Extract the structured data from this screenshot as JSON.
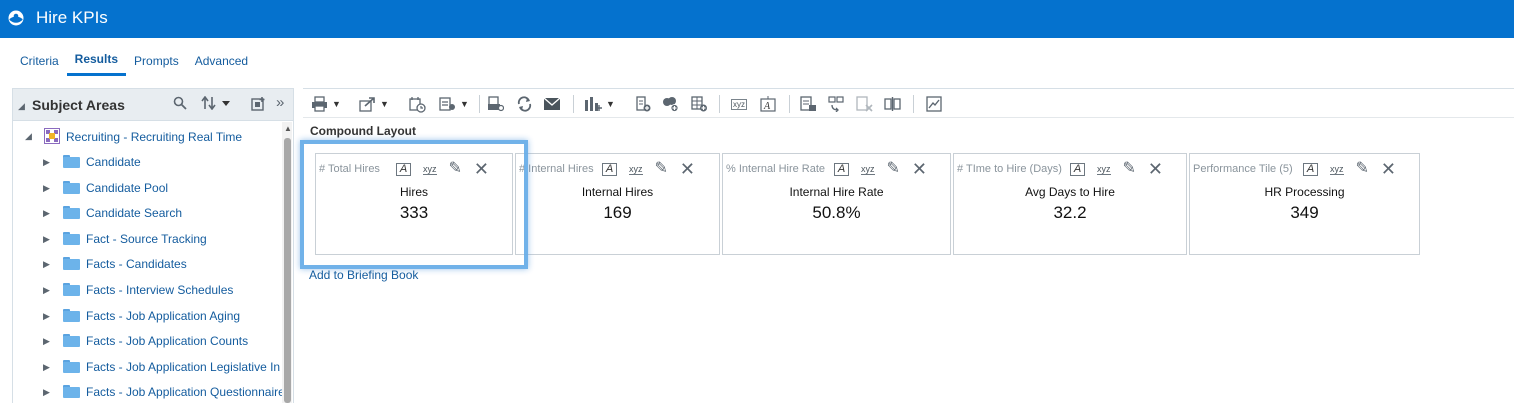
{
  "header": {
    "title": "Hire KPIs"
  },
  "tabs": [
    {
      "label": "Criteria"
    },
    {
      "label": "Results"
    },
    {
      "label": "Prompts"
    },
    {
      "label": "Advanced"
    }
  ],
  "subject_areas": {
    "title": "Subject Areas",
    "root": "Recruiting - Recruiting Real Time",
    "items": [
      "Candidate",
      "Candidate Pool",
      "Candidate Search",
      "Fact - Source Tracking",
      "Facts - Candidates",
      "Facts - Interview Schedules",
      "Facts - Job Application Aging",
      "Facts - Job Application Counts",
      "Facts - Job Application Legislative In",
      "Facts - Job Application Questionnaire"
    ]
  },
  "compound_layout": {
    "title": "Compound Layout",
    "add_to_briefing": "Add to Briefing Book"
  },
  "tiles": [
    {
      "label": "# Total Hires",
      "name": "Hires",
      "value": "333"
    },
    {
      "label": "# Internal Hires",
      "name": "Internal Hires",
      "value": "169"
    },
    {
      "label": "% Internal Hire Rate",
      "name": "Internal Hire Rate",
      "value": "50.8%"
    },
    {
      "label": "# TIme to Hire (Days)",
      "name": "Avg Days to Hire",
      "value": "32.2"
    },
    {
      "label": "Performance Tile (5)",
      "name": "HR Processing",
      "value": "349"
    }
  ],
  "icons": {
    "rename": "A",
    "format": "xyz"
  },
  "colors": {
    "header_bg": "#0572ce",
    "link": "#145c9e",
    "highlight": "#6aaee8"
  }
}
